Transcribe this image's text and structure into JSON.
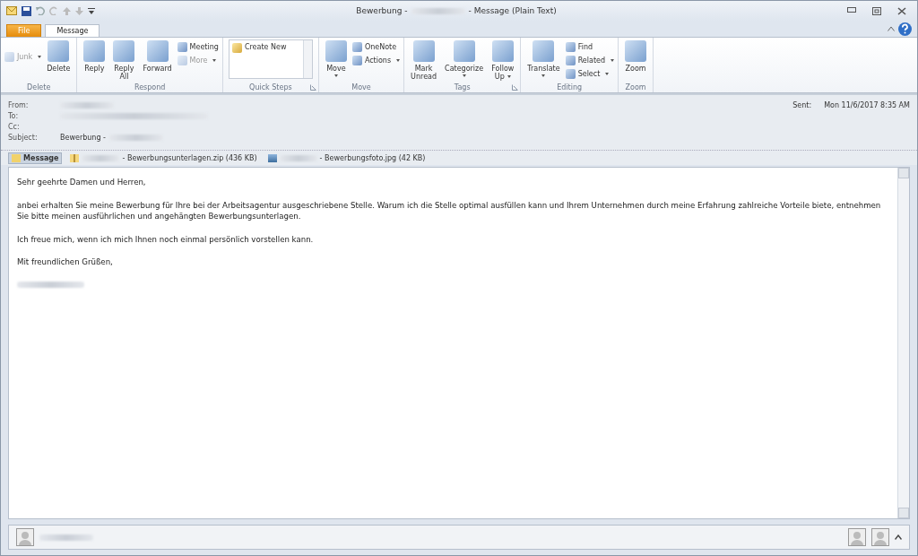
{
  "window": {
    "title_start": "Bewerbung -",
    "title_end": "- Message (Plain Text)"
  },
  "tabs": [
    {
      "label": "File",
      "kind": "file",
      "selected": false
    },
    {
      "label": "Message",
      "kind": "tab",
      "selected": true
    }
  ],
  "ribbon": [
    {
      "name": "Delete",
      "launcher": false,
      "items": [
        {
          "kind": "small",
          "lines": [
            "Junk"
          ],
          "disabled": true,
          "dropdown": true
        },
        {
          "kind": "large",
          "lines": [
            "Delete"
          ],
          "disabled": false,
          "dropdown": false
        }
      ]
    },
    {
      "name": "Respond",
      "launcher": false,
      "items": [
        {
          "kind": "large",
          "lines": [
            "Reply"
          ],
          "disabled": false,
          "dropdown": false
        },
        {
          "kind": "large",
          "lines": [
            "Reply",
            "All"
          ],
          "disabled": false,
          "dropdown": false
        },
        {
          "kind": "large",
          "lines": [
            "Forward"
          ],
          "disabled": false,
          "dropdown": false
        },
        {
          "kind": "stack",
          "children": [
            {
              "lines": [
                "Meeting"
              ],
              "disabled": false,
              "dropdown": false
            },
            {
              "lines": [
                "More"
              ],
              "disabled": true,
              "dropdown": true
            }
          ]
        }
      ]
    },
    {
      "name": "Quick Steps",
      "launcher": true,
      "items": [
        {
          "kind": "gallery",
          "lines": [
            "Create New"
          ]
        }
      ]
    },
    {
      "name": "Move",
      "launcher": false,
      "items": [
        {
          "kind": "large",
          "lines": [
            "Move"
          ],
          "disabled": false,
          "dropdown": true
        },
        {
          "kind": "stack",
          "children": [
            {
              "lines": [
                "OneNote"
              ],
              "disabled": false,
              "dropdown": false
            },
            {
              "lines": [
                "Actions"
              ],
              "disabled": false,
              "dropdown": true
            }
          ]
        }
      ]
    },
    {
      "name": "Tags",
      "launcher": true,
      "items": [
        {
          "kind": "large",
          "lines": [
            "Mark",
            "Unread"
          ],
          "disabled": false,
          "dropdown": false
        },
        {
          "kind": "large",
          "lines": [
            "Categorize"
          ],
          "disabled": false,
          "dropdown": true
        },
        {
          "kind": "large",
          "lines": [
            "Follow",
            "Up"
          ],
          "disabled": false,
          "dropdown": true
        }
      ]
    },
    {
      "name": "Editing",
      "launcher": false,
      "items": [
        {
          "kind": "large",
          "lines": [
            "Translate"
          ],
          "disabled": false,
          "dropdown": true
        },
        {
          "kind": "stack",
          "children": [
            {
              "lines": [
                "Find"
              ],
              "disabled": false,
              "dropdown": false
            },
            {
              "lines": [
                "Related"
              ],
              "disabled": false,
              "dropdown": true
            },
            {
              "lines": [
                "Select"
              ],
              "disabled": false,
              "dropdown": true
            }
          ]
        }
      ]
    },
    {
      "name": "Zoom",
      "launcher": false,
      "items": [
        {
          "kind": "large",
          "lines": [
            "Zoom"
          ],
          "disabled": false,
          "dropdown": false
        }
      ]
    }
  ],
  "header": {
    "fields": [
      {
        "label": "From:",
        "redacted": true
      },
      {
        "label": "To:",
        "redacted": true
      },
      {
        "label": "Cc:",
        "redacted": false
      },
      {
        "label": "Subject:",
        "value": "Bewerbung -",
        "redacted": true
      }
    ],
    "sent_label": "Sent:",
    "sent": "Mon 11/6/2017 8:35 AM"
  },
  "attachments": [
    {
      "kind": "message",
      "label": "Message",
      "selected": true
    },
    {
      "kind": "zip",
      "label": "- Bewerbungsunterlagen.zip (436 KB)",
      "selected": false
    },
    {
      "kind": "image",
      "label": "- Bewerbungsfoto.jpg (42 KB)",
      "selected": false
    }
  ],
  "body": {
    "paragraphs": [
      "Sehr geehrte Damen und Herren,",
      "anbei erhalten Sie meine Bewerbung für Ihre bei der Arbeitsagentur ausgeschriebene Stelle. Warum ich die Stelle optimal ausfüllen kann und Ihrem Unternehmen durch meine Erfahrung zahlreiche Vorteile biete, entnehmen Sie bitte meinen ausführlichen und angehängten Bewerbungsunterlagen.",
      "Ich freue mich, wenn ich mich Ihnen noch einmal persönlich vorstellen kann.",
      "Mit freundlichen Grüßen,"
    ],
    "signature_redacted": true
  },
  "people_pane": {
    "name_redacted": true,
    "expanded": false
  }
}
